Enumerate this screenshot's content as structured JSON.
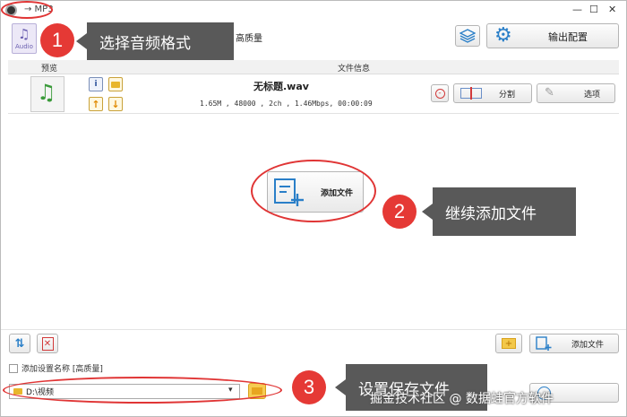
{
  "titlebar": {
    "title": "→ MP3",
    "minimize": "—",
    "maximize": "☐",
    "close": "✕"
  },
  "toolbar": {
    "format_label": "Audio",
    "quality": "高质量",
    "output_config": "输出配置"
  },
  "table": {
    "col_preview": "预览",
    "col_fileinfo": "文件信息"
  },
  "file": {
    "name": "无标题.wav",
    "details": "1.65M , 48000 , 2ch , 1.46Mbps, 00:00:09",
    "split": "分割",
    "options": "选项"
  },
  "center": {
    "add_file": "添加文件"
  },
  "bottom": {
    "add_file": "添加文件",
    "add_setting_name": "添加设置名称 [高质量]",
    "path": "D:\\视频"
  },
  "callouts": {
    "c1_num": "1",
    "c1_text": "选择音频格式",
    "c2_num": "2",
    "c2_text": "继续添加文件",
    "c3_num": "3",
    "c3_text": "设置保存文件"
  },
  "watermark": "掘金技术社区 @ 数据蛙官方软件",
  "colors": {
    "accent_blue": "#2a7fc8",
    "annotation_red": "#e53935",
    "callout_gray": "#595959"
  }
}
